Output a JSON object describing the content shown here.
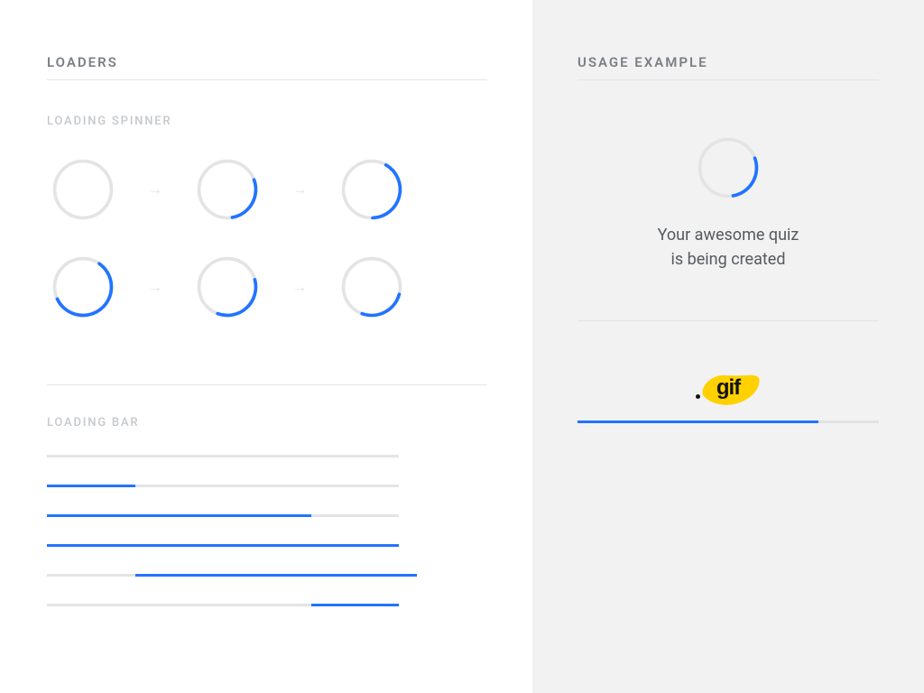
{
  "left": {
    "title": "LOADERS",
    "spinner_label": "LOADING SPINNER",
    "bar_label": "LOADING BAR",
    "spinners": [
      {
        "start": 0,
        "end": 0
      },
      {
        "start": 70,
        "end": 170
      },
      {
        "start": 30,
        "end": 178
      },
      {
        "start": 35,
        "end": 245
      },
      {
        "start": 75,
        "end": 200
      },
      {
        "start": 105,
        "end": 200
      }
    ],
    "bars": [
      {
        "start": 0,
        "pct": 0
      },
      {
        "start": 0,
        "pct": 25
      },
      {
        "start": 0,
        "pct": 75
      },
      {
        "start": 0,
        "pct": 100
      },
      {
        "start": 25,
        "pct": 80
      },
      {
        "start": 75,
        "pct": 25
      }
    ]
  },
  "right": {
    "title": "USAGE EXAMPLE",
    "spinner": {
      "start": 70,
      "end": 170
    },
    "message_line1": "Your awesome quiz",
    "message_line2": "is being created",
    "gif_label": "gif",
    "bar": {
      "pct": 80
    }
  },
  "colors": {
    "accent": "#2174ff",
    "track": "#e3e4e6",
    "gif_yellow": "#ffd100"
  }
}
